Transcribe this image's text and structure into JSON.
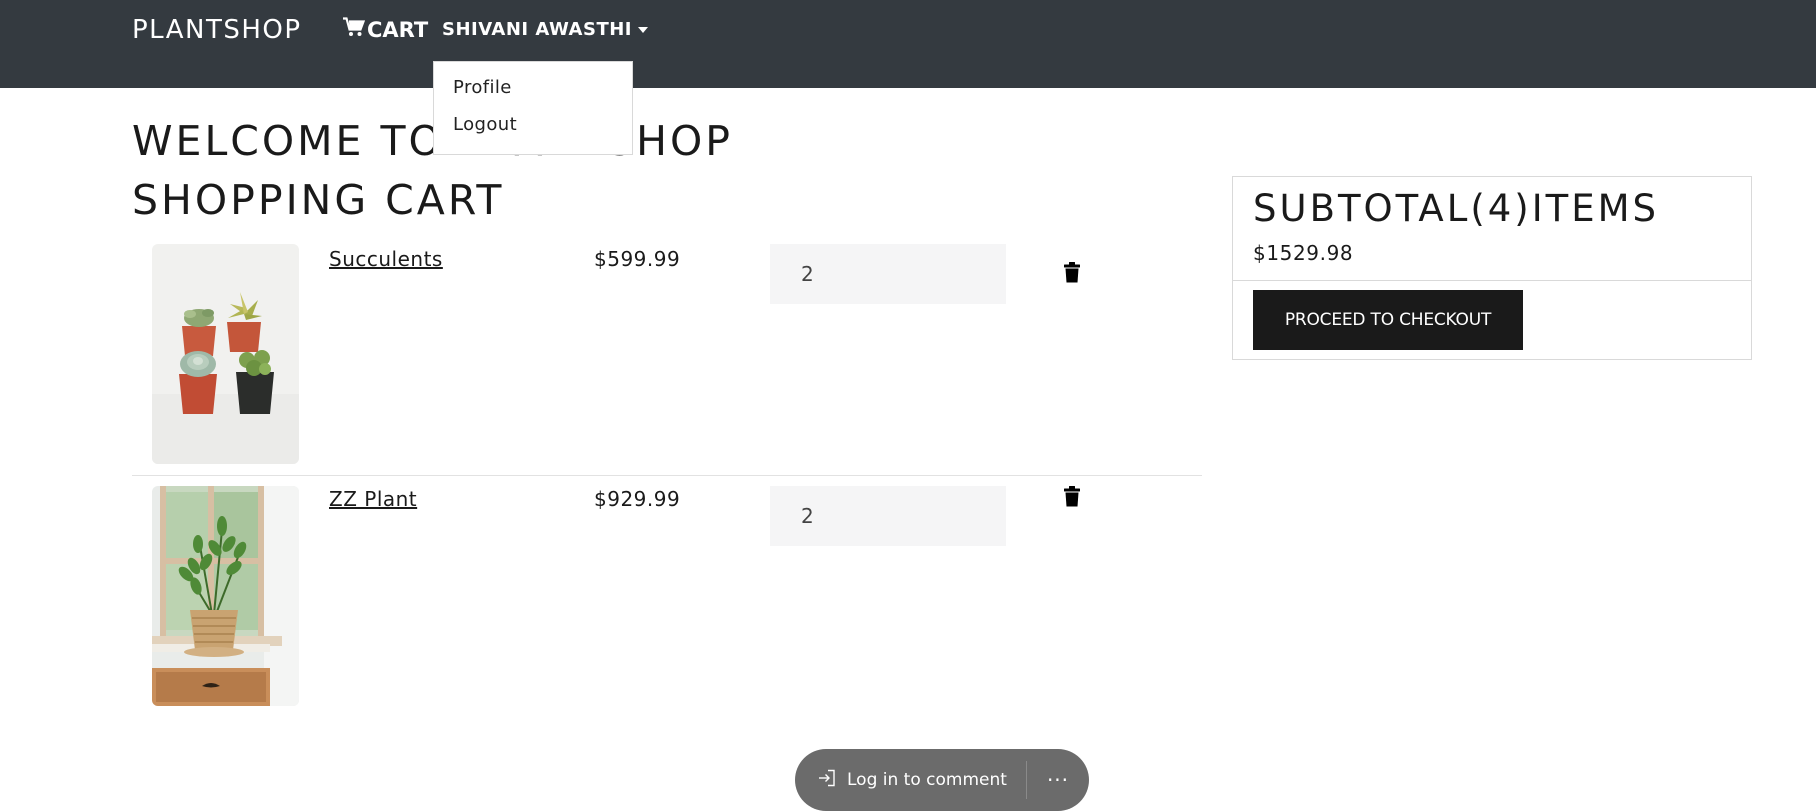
{
  "navbar": {
    "brand": "PLANTSHOP",
    "cart_label": "CART",
    "user_name": "SHIVANI AWASTHI",
    "dropdown": [
      "Profile",
      "Logout"
    ]
  },
  "main": {
    "welcome_title": "WELCOME TO PLANTSHOP",
    "cart_title": "SHOPPING CART"
  },
  "cart": {
    "items": [
      {
        "name": "Succulents",
        "price": "$599.99",
        "quantity": "2"
      },
      {
        "name": "ZZ Plant",
        "price": "$929.99",
        "quantity": "2"
      }
    ]
  },
  "summary": {
    "title": "SUBTOTAL(4)ITEMS",
    "total": "$1529.98",
    "checkout_label": "PROCEED TO CHECKOUT"
  },
  "comment_bar": {
    "login_label": "Log in to comment",
    "more_label": "···"
  },
  "colors": {
    "navbar": "#343a40",
    "button": "#1a1a1a",
    "qty_bg": "#f5f5f6",
    "comment_pill": "#6b6b6b"
  }
}
